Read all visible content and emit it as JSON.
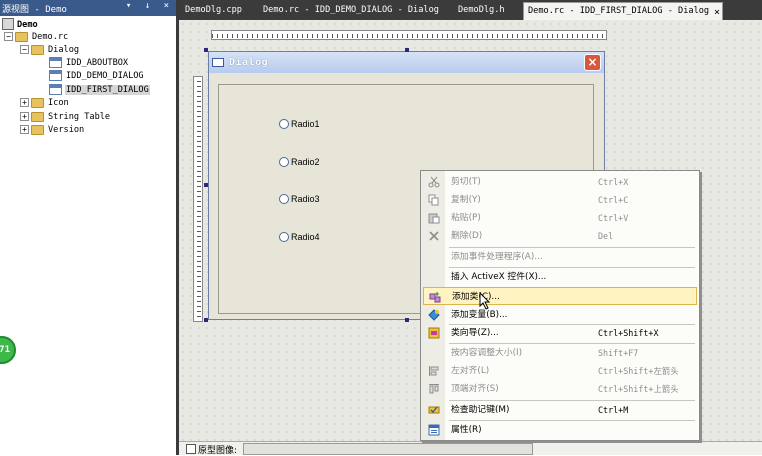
{
  "left_panel": {
    "title": "源视图 - Demo",
    "buttons": "▾ ↓ ×",
    "tree": {
      "root": "Demo",
      "rc": "Demo.rc",
      "dialog_folder": "Dialog",
      "dialogs": [
        "IDD_ABOUTBOX",
        "IDD_DEMO_DIALOG",
        "IDD_FIRST_DIALOG"
      ],
      "icon_folder": "Icon",
      "string_folder": "String Table",
      "version_folder": "Version",
      "expanded_glyph": "−",
      "collapsed_glyph": "+"
    },
    "badge": "71"
  },
  "tabs": [
    "DemoDlg.cpp",
    "Demo.rc - IDD_DEMO_DIALOG - Dialog",
    "DemoDlg.h",
    "Demo.rc - IDD_FIRST_DIALOG - Dialog"
  ],
  "tab_close": "×",
  "dialog": {
    "title": "Dialog",
    "close_glyph": "×",
    "radios": [
      "Radio1",
      "Radio2",
      "Radio3",
      "Radio4"
    ]
  },
  "bottom_bar": {
    "preview_label": "原型图像:"
  },
  "context_menu": {
    "items": [
      {
        "label": "剪切(T)",
        "shortcut": "Ctrl+X",
        "disabled": true,
        "icon": "scissors-icon"
      },
      {
        "label": "复制(Y)",
        "shortcut": "Ctrl+C",
        "disabled": true,
        "icon": "copy-icon"
      },
      {
        "label": "粘贴(P)",
        "shortcut": "Ctrl+V",
        "disabled": true,
        "icon": "paste-icon"
      },
      {
        "label": "删除(D)",
        "shortcut": "Del",
        "disabled": true,
        "icon": "delete-icon"
      },
      {
        "label": "添加事件处理程序(A)...",
        "shortcut": "",
        "disabled": true
      },
      {
        "label": "插入 ActiveX 控件(X)...",
        "shortcut": "",
        "disabled": false
      },
      {
        "label": "添加类(C)...",
        "shortcut": "",
        "disabled": false,
        "icon": "add-class-icon",
        "highlighted": true
      },
      {
        "label": "添加变量(B)...",
        "shortcut": "",
        "disabled": false,
        "icon": "add-variable-icon"
      },
      {
        "label": "类向导(Z)...",
        "shortcut": "Ctrl+Shift+X",
        "disabled": false,
        "icon": "class-wizard-icon"
      },
      {
        "label": "按内容调整大小(I)",
        "shortcut": "Shift+F7",
        "disabled": true
      },
      {
        "label": "左对齐(L)",
        "shortcut": "Ctrl+Shift+左箭头",
        "disabled": true,
        "icon": "align-left-icon"
      },
      {
        "label": "顶端对齐(S)",
        "shortcut": "Ctrl+Shift+上箭头",
        "disabled": true,
        "icon": "align-top-icon"
      },
      {
        "label": "检查助记键(M)",
        "shortcut": "Ctrl+M",
        "disabled": false,
        "icon": "check-mnemonics-icon"
      },
      {
        "label": "属性(R)",
        "shortcut": "",
        "disabled": false,
        "icon": "properties-icon"
      }
    ]
  },
  "colors": {
    "tab_bar": "#3b3b3b",
    "highlight": "#fff3c2",
    "dialog_face": "#e6e5d8"
  }
}
